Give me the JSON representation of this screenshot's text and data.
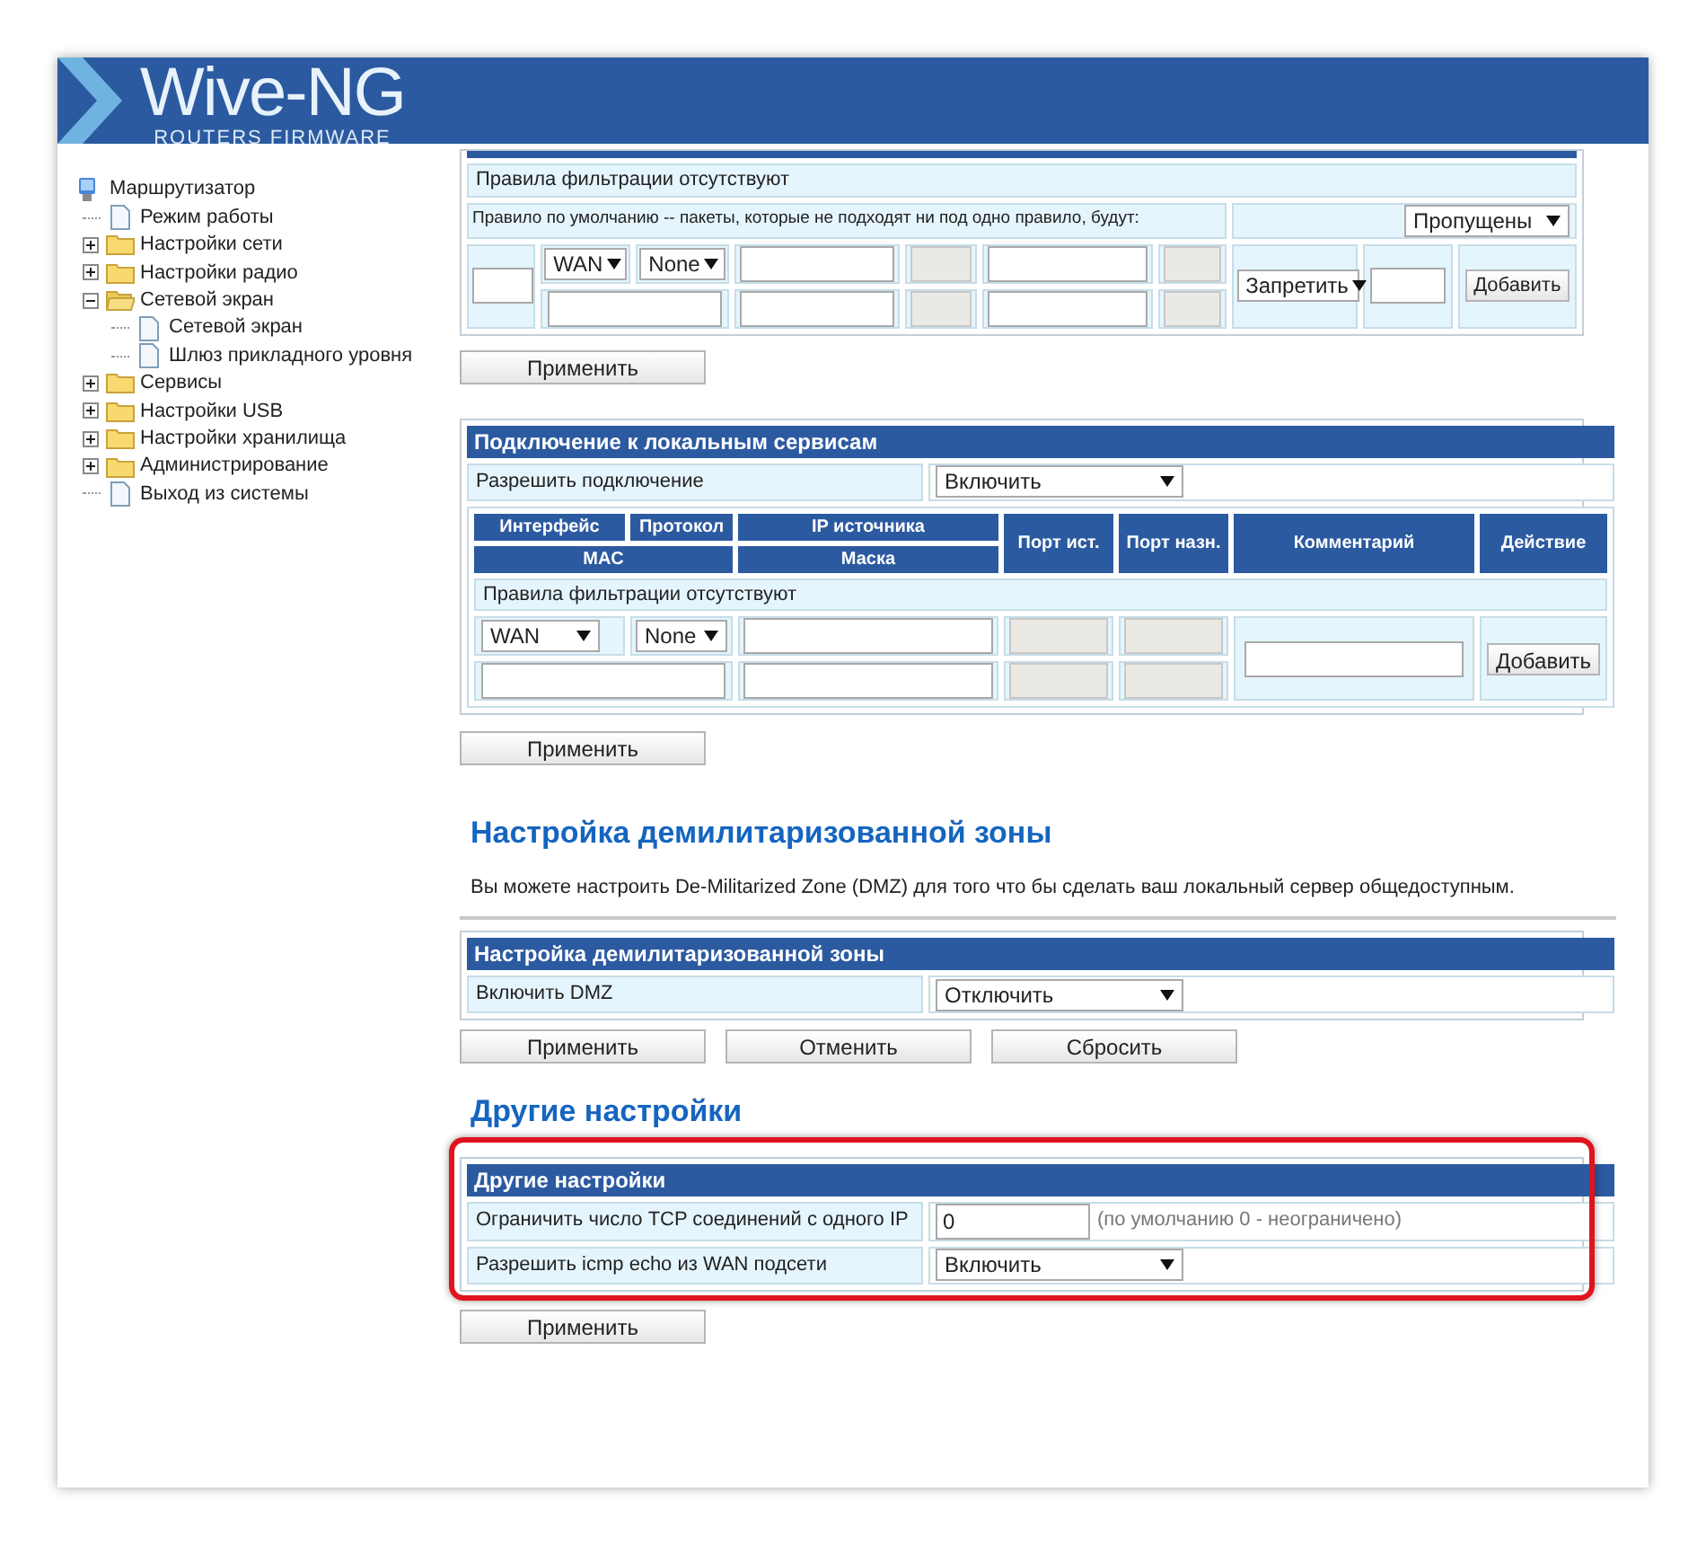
{
  "header": {
    "title": "Wive-NG",
    "subtitle": "ROUTERS FIRMWARE"
  },
  "tree": {
    "label": "Маршрутизатор",
    "kind": "root",
    "children": [
      {
        "label": "Режим работы",
        "kind": "page"
      },
      {
        "label": "Настройки сети",
        "kind": "folder",
        "expanded": false
      },
      {
        "label": "Настройки радио",
        "kind": "folder",
        "expanded": false
      },
      {
        "label": "Сетевой экран",
        "kind": "folder",
        "expanded": true,
        "children": [
          {
            "label": "Сетевой экран",
            "kind": "page"
          },
          {
            "label": "Шлюз прикладного уровня",
            "kind": "page"
          }
        ]
      },
      {
        "label": "Сервисы",
        "kind": "folder",
        "expanded": false
      },
      {
        "label": "Настройки USB",
        "kind": "folder",
        "expanded": false
      },
      {
        "label": "Настройки хранилища",
        "kind": "folder",
        "expanded": false
      },
      {
        "label": "Администрирование",
        "kind": "folder",
        "expanded": false
      },
      {
        "label": "Выход из системы",
        "kind": "page"
      }
    ]
  },
  "filter_rules": {
    "empty_message": "Правила фильтрации отсутствуют",
    "default_rule_label": "Правило по умолчанию -- пакеты, которые не подходят ни под одно правило, будут:",
    "default_rule_value": "Пропущены",
    "interface": "WAN",
    "protocol": "None",
    "port_fields_disabled": true,
    "action": "Запретить",
    "add_button": "Добавить",
    "apply_button": "Применить"
  },
  "local_services": {
    "title": "Подключение к локальным сервисам",
    "allow_label": "Разрешить подключение",
    "allow_value": "Включить",
    "columns": [
      "Интерфейс",
      "Протокол",
      "IP источника",
      "MAC",
      "Маска",
      "Порт ист.",
      "Порт назн.",
      "Комментарий",
      "Действие"
    ],
    "empty_message": "Правила фильтрации отсутствуют",
    "interface": "WAN",
    "protocol": "None",
    "port_fields_disabled": true,
    "add_button": "Добавить",
    "apply_button": "Применить"
  },
  "dmz": {
    "heading": "Настройка демилитаризованной зоны",
    "description": "Вы можете настроить De-Militarized Zone (DMZ) для того что бы сделать ваш локальный сервер общедоступным.",
    "table_title": "Настройка демилитаризованной зоны",
    "enable_label": "Включить DMZ",
    "enable_value": "Отключить",
    "buttons": [
      "Применить",
      "Отменить",
      "Сбросить"
    ]
  },
  "other": {
    "heading": "Другие настройки",
    "table_title": "Другие настройки",
    "highlighted": true,
    "tcp_limit_label": "Ограничить число TCP соединений с одного IP",
    "tcp_limit_value": "0",
    "tcp_limit_hint": "(по умолчанию 0 - неограничено)",
    "icmp_label": "Разрешить icmp echo из WAN подсети",
    "icmp_value": "Включить",
    "apply_button": "Применить"
  }
}
